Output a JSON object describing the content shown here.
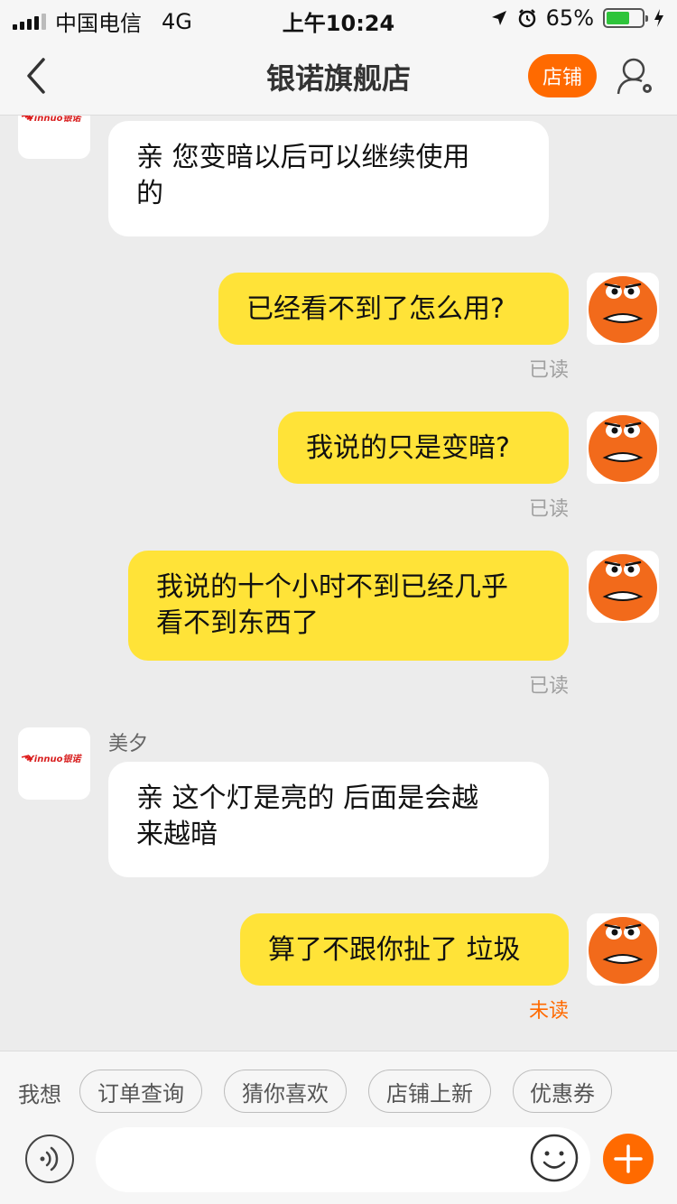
{
  "status_bar": {
    "carrier": "中国电信",
    "network": "4G",
    "time": "上午10:24",
    "battery": "65%",
    "battery_level": 0.65
  },
  "nav": {
    "title": "银诺旗舰店",
    "shop_button": "店铺"
  },
  "shop_logo_text": "Yinnuo银诺",
  "messages": [
    {
      "side": "left",
      "text_lines": [
        "亲 您变暗以后可以继续使用",
        "的"
      ]
    },
    {
      "side": "right",
      "text_lines": [
        "已经看不到了怎么用?"
      ],
      "status": "已读"
    },
    {
      "side": "right",
      "text_lines": [
        "我说的只是变暗?"
      ],
      "status": "已读"
    },
    {
      "side": "right",
      "text_lines": [
        "我说的十个小时不到已经几乎",
        "看不到东西了"
      ],
      "status": "已读"
    },
    {
      "side": "left",
      "sender": "美夕",
      "text_lines": [
        "亲 这个灯是亮的  后面是会越",
        "来越暗"
      ]
    },
    {
      "side": "right",
      "text_lines": [
        "算了不跟你扯了 垃圾"
      ],
      "status": "未读"
    }
  ],
  "quick_bar": {
    "label": "我想",
    "chips": [
      "订单查询",
      "猜你喜欢",
      "店铺上新",
      "优惠券"
    ]
  },
  "input": {
    "value": "",
    "placeholder": ""
  },
  "colors": {
    "accent": "#ff6a00",
    "my_bubble": "#ffe338",
    "their_bubble": "#ffffff",
    "background": "#ececec"
  },
  "icons": {
    "back": "chevron-left-icon",
    "profile": "person-settings-icon",
    "voice": "voice-icon",
    "emoji": "smiley-icon",
    "plus": "plus-icon"
  }
}
